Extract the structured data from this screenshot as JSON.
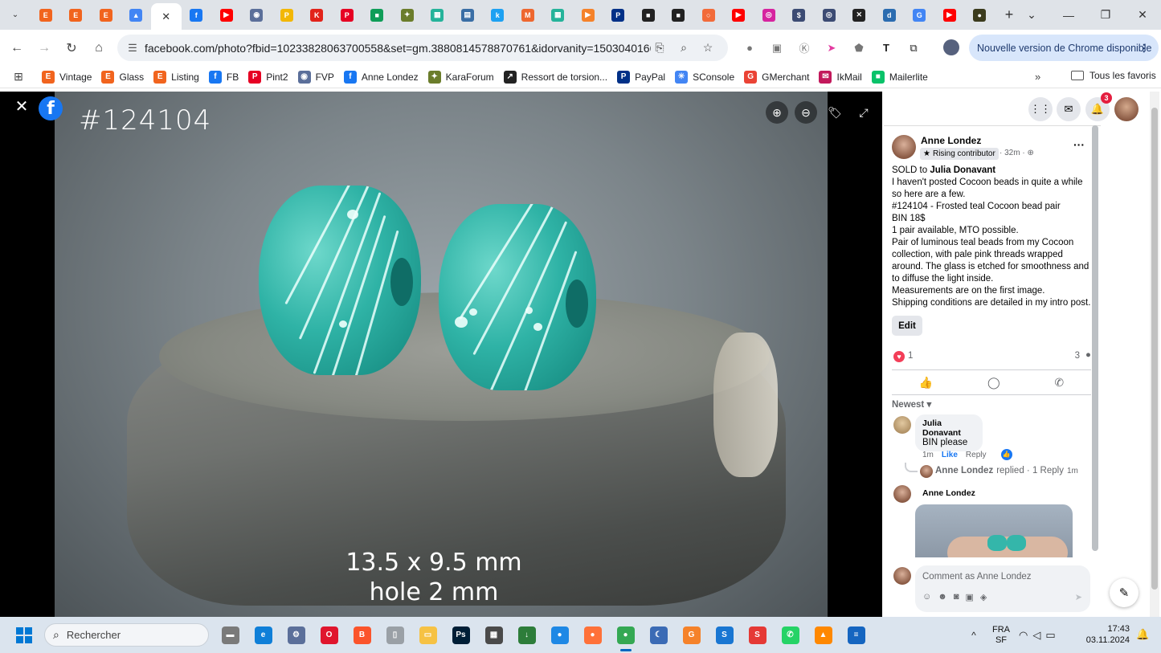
{
  "browser": {
    "tabs": [
      {
        "icon": "etsy-icon",
        "glyph": "E",
        "color": "#f1641e"
      },
      {
        "icon": "etsy-circle-icon",
        "glyph": "E",
        "color": "#f1641e"
      },
      {
        "icon": "etsy-circle-icon",
        "glyph": "E",
        "color": "#f1641e"
      },
      {
        "icon": "drive-icon",
        "glyph": "▲",
        "color": "#4285f4"
      },
      {
        "icon": "close-icon",
        "glyph": "✕",
        "color": "#ffffff",
        "active": true
      },
      {
        "icon": "facebook-icon",
        "glyph": "f",
        "color": "#1877f2"
      },
      {
        "icon": "youtube-icon",
        "glyph": "▶",
        "color": "#ff0000"
      },
      {
        "icon": "fvp-icon",
        "glyph": "◉",
        "color": "#5b6f9a"
      },
      {
        "icon": "beads-icon",
        "glyph": "P",
        "color": "#f2b705"
      },
      {
        "icon": "k-icon",
        "glyph": "K",
        "color": "#e2231a"
      },
      {
        "icon": "pinterest-icon",
        "glyph": "P",
        "color": "#e60023"
      },
      {
        "icon": "chat-icon",
        "glyph": "■",
        "color": "#0f9d58"
      },
      {
        "icon": "turtle-icon",
        "glyph": "✦",
        "color": "#6b7d2b"
      },
      {
        "icon": "grid-icon",
        "glyph": "▦",
        "color": "#25b39a"
      },
      {
        "icon": "printer-icon",
        "glyph": "▤",
        "color": "#3a6ea5"
      },
      {
        "icon": "k-blue-icon",
        "glyph": "k",
        "color": "#1da1f2"
      },
      {
        "icon": "magento-icon",
        "glyph": "M",
        "color": "#ee672f"
      },
      {
        "icon": "grid-icon",
        "glyph": "▦",
        "color": "#25b39a"
      },
      {
        "icon": "play-icon",
        "glyph": "▶",
        "color": "#f5822a"
      },
      {
        "icon": "paypal-icon",
        "glyph": "P",
        "color": "#003087"
      },
      {
        "icon": "bw-icon",
        "glyph": "■",
        "color": "#222222"
      },
      {
        "icon": "bw-icon",
        "glyph": "■",
        "color": "#222222"
      },
      {
        "icon": "ring-icon",
        "glyph": "○",
        "color": "#f26b3a"
      },
      {
        "icon": "youtube-icon",
        "glyph": "▶",
        "color": "#ff0000"
      },
      {
        "icon": "instagram-icon",
        "glyph": "◎",
        "color": "#d6249f"
      },
      {
        "icon": "dollar-icon",
        "glyph": "$",
        "color": "#3c4b73"
      },
      {
        "icon": "compass-icon",
        "glyph": "◎",
        "color": "#3c4b73"
      },
      {
        "icon": "butterfly-icon",
        "glyph": "✕",
        "color": "#222222"
      },
      {
        "icon": "d-icon",
        "glyph": "d",
        "color": "#2b6cb0"
      },
      {
        "icon": "google-icon",
        "glyph": "G",
        "color": "#4285f4"
      },
      {
        "icon": "youtube-icon",
        "glyph": "▶",
        "color": "#ff0000"
      },
      {
        "icon": "ball-icon",
        "glyph": "●",
        "color": "#3b3b1d"
      }
    ],
    "url": "facebook.com/photo?fbid=10233828063700558&set=gm.3880814578870761&idorvanity=15030401666...",
    "update_text": "Nouvelle version de Chrome disponible",
    "bookmarks": [
      {
        "label": "Vintage",
        "icon": "etsy-icon",
        "glyph": "E",
        "color": "#f1641e"
      },
      {
        "label": "Glass",
        "icon": "etsy-icon",
        "glyph": "E",
        "color": "#f1641e"
      },
      {
        "label": "Listing",
        "icon": "etsy-icon",
        "glyph": "E",
        "color": "#f1641e"
      },
      {
        "label": "FB",
        "icon": "facebook-icon",
        "glyph": "f",
        "color": "#1877f2"
      },
      {
        "label": "Pint2",
        "icon": "pinterest-icon",
        "glyph": "P",
        "color": "#e60023"
      },
      {
        "label": "FVP",
        "icon": "fvp-icon",
        "glyph": "◉",
        "color": "#5b6f9a"
      },
      {
        "label": "Anne Londez",
        "icon": "facebook-icon",
        "glyph": "f",
        "color": "#1877f2"
      },
      {
        "label": "KaraForum",
        "icon": "turtle-icon",
        "glyph": "✦",
        "color": "#6b7d2b"
      },
      {
        "label": "Ressort de torsion...",
        "icon": "spring-icon",
        "glyph": "↗",
        "color": "#222222"
      },
      {
        "label": "PayPal",
        "icon": "paypal-icon",
        "glyph": "P",
        "color": "#003087"
      },
      {
        "label": "SConsole",
        "icon": "sconsole-icon",
        "glyph": "✳",
        "color": "#4285f4"
      },
      {
        "label": "GMerchant",
        "icon": "gmerchant-icon",
        "glyph": "G",
        "color": "#ea4335"
      },
      {
        "label": "IkMail",
        "icon": "ikmail-icon",
        "glyph": "✉",
        "color": "#c2185b"
      },
      {
        "label": "Mailerlite",
        "icon": "mailerlite-icon",
        "glyph": "■",
        "color": "#09c269"
      }
    ],
    "all_bookmarks": "Tous les favoris"
  },
  "photo": {
    "code": "#124104",
    "measure_line1": "13.5 x 9.5 mm",
    "measure_line2": "hole 2 mm"
  },
  "post": {
    "author": "Anne Londez",
    "badge": "Rising contributor",
    "time": "32m",
    "sold_prefix": "SOLD to",
    "sold_to": "Julia Donavant",
    "lines": [
      "I haven't posted Cocoon beads in quite a while so here are a few.",
      "#124104 - Frosted teal Cocoon bead pair",
      "BIN 18$",
      "1 pair available, MTO possible.",
      "Pair of luminous teal beads from my Cocoon collection, with pale pink threads wrapped around. The glass is etched for smoothness and to diffuse the light inside.",
      "Measurements are on the first image.",
      "Shipping conditions are detailed in my intro post."
    ],
    "edit_label": "Edit",
    "reactions": "1",
    "comments_count": "3",
    "sort_label": "Newest"
  },
  "comments": {
    "c1_name": "Julia Donavant",
    "c1_text": "BIN please",
    "c1_time": "1m",
    "c1_like": "Like",
    "c1_reply": "Reply",
    "replied_name": "Anne Londez",
    "replied_text": "replied · 1 Reply",
    "replied_time": "1m",
    "c2_name": "Anne Londez",
    "composer_placeholder": "Comment as Anne Londez"
  },
  "notifications": {
    "count": "3"
  },
  "taskbar": {
    "search_placeholder": "Rechercher",
    "lang_line1": "FRA",
    "lang_line2": "SF",
    "time": "17:43",
    "date": "03.11.2024",
    "apps": [
      {
        "icon": "file-explorer-icon",
        "glyph": "▬",
        "color": "#7a7a7a"
      },
      {
        "icon": "edge-icon",
        "glyph": "e",
        "color": "#0f7fd8"
      },
      {
        "icon": "settings-icon",
        "glyph": "⚙",
        "color": "#5b6f9a"
      },
      {
        "icon": "opera-icon",
        "glyph": "O",
        "color": "#e0152d"
      },
      {
        "icon": "brave-icon",
        "glyph": "B",
        "color": "#fb542b"
      },
      {
        "icon": "notepad-icon",
        "glyph": "▯",
        "color": "#9aa0a6"
      },
      {
        "icon": "folder-icon",
        "glyph": "▭",
        "color": "#f6c244"
      },
      {
        "icon": "photoshop-icon",
        "glyph": "Ps",
        "color": "#001e36"
      },
      {
        "icon": "calculator-icon",
        "glyph": "▦",
        "color": "#4a4a4a"
      },
      {
        "icon": "installer-icon",
        "glyph": "↓",
        "color": "#2d7d3a"
      },
      {
        "icon": "globe-icon",
        "glyph": "●",
        "color": "#1e88e5"
      },
      {
        "icon": "firefox-icon",
        "glyph": "●",
        "color": "#ff7139"
      },
      {
        "icon": "chrome-icon",
        "glyph": "●",
        "color": "#34a853",
        "active": true
      },
      {
        "icon": "moon-icon",
        "glyph": "☾",
        "color": "#3b6bb5"
      },
      {
        "icon": "pages-icon",
        "glyph": "G",
        "color": "#f5822a"
      },
      {
        "icon": "s-blue-icon",
        "glyph": "S",
        "color": "#1976d2"
      },
      {
        "icon": "s-red-icon",
        "glyph": "S",
        "color": "#e53935"
      },
      {
        "icon": "whatsapp-icon",
        "glyph": "✆",
        "color": "#25d366"
      },
      {
        "icon": "vlc-icon",
        "glyph": "▲",
        "color": "#ff8800"
      },
      {
        "icon": "doc-icon",
        "glyph": "≡",
        "color": "#1565c0"
      }
    ]
  }
}
